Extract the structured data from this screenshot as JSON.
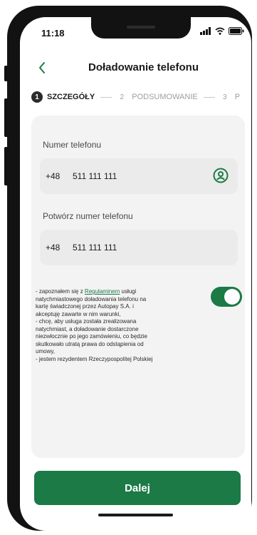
{
  "status": {
    "time": "11:18"
  },
  "header": {
    "title": "Doładowanie telefonu"
  },
  "stepper": {
    "steps": [
      {
        "number": "1",
        "label": "SZCZEGÓŁY",
        "active": true
      },
      {
        "number": "2",
        "label": "PODSUMOWANIE",
        "active": false
      },
      {
        "number": "3",
        "label": "P",
        "active": false
      }
    ]
  },
  "form": {
    "phone": {
      "label": "Numer telefonu",
      "prefix": "+48",
      "value": "511 111 111"
    },
    "confirm_phone": {
      "label": "Potwórz numer telefonu",
      "prefix": "+48",
      "value": "511 111 111"
    }
  },
  "consent": {
    "lines": [
      "- zapoznałem się z ",
      "Regulaminem",
      " usługi",
      "natychmiastowego doładowania telefonu na",
      "kartę świadczonej przez Autopay S.A. i",
      "akceptuję zawarte w nim warunki,",
      "- chcę, aby usługa została zrealizowana",
      "natychmiast, a doładowanie dostarczone",
      "niezwłocznie po jego zamówieniu, co będzie",
      "skutkowało utratą prawa do odstąpienia od",
      "umowy,",
      "- jestem rezydentem Rzeczypospolitej Polskiej"
    ],
    "toggle_on": true
  },
  "actions": {
    "next_label": "Dalej"
  },
  "colors": {
    "accent": "#1b7a46",
    "card_bg": "#f3f3f4",
    "input_bg": "#ebebeb"
  },
  "icons": {
    "back": "chevron-left-icon",
    "contact": "contact-person-icon",
    "signal": "signal-icon",
    "wifi": "wifi-icon",
    "battery": "battery-icon"
  }
}
